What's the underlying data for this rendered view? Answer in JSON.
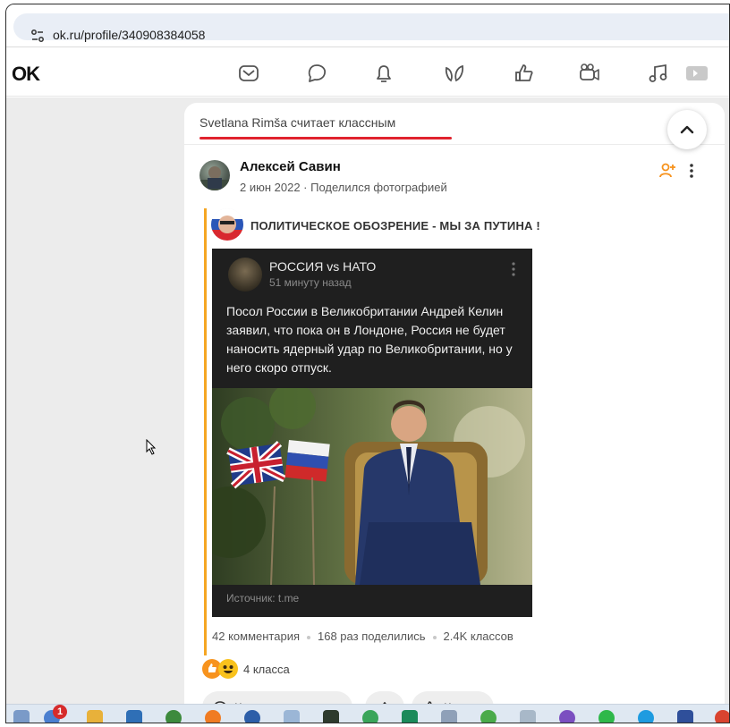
{
  "browser": {
    "url": "ok.ru/profile/340908384058"
  },
  "site": {
    "logo": "OK",
    "nav_icons": [
      "mail-icon",
      "chat-icon",
      "bell-icon",
      "guests-icon",
      "like-icon",
      "video-icon",
      "music-icon",
      "game-icon"
    ]
  },
  "feed": {
    "header": "Svetlana Rimša считает классным",
    "author": "Алексей Савин",
    "meta": "2 июн 2022 · Поделился фотографией",
    "group_title": "ПОЛИТИЧЕСКОЕ ОБОЗРЕНИЕ - МЫ ЗА ПУТИНА !",
    "embedded_post": {
      "channel": "РОССИЯ vs НАТО",
      "time": "51 минуту назад",
      "text": "Посол России в Великобритании Андрей Келин заявил, что пока он в Лондоне, Россия не будет наносить ядерный удар по Великобритании, но у него скоро отпуск.",
      "source": "Источник: t.me"
    },
    "stats": {
      "comments": "42 комментария",
      "shares": "168 раз поделились",
      "klass": "2.4K классов"
    },
    "likes_label": "4 класса",
    "buttons": {
      "comment": "Комментировать",
      "klass": "Класс"
    }
  },
  "taskbar": {
    "badge": "1"
  }
}
